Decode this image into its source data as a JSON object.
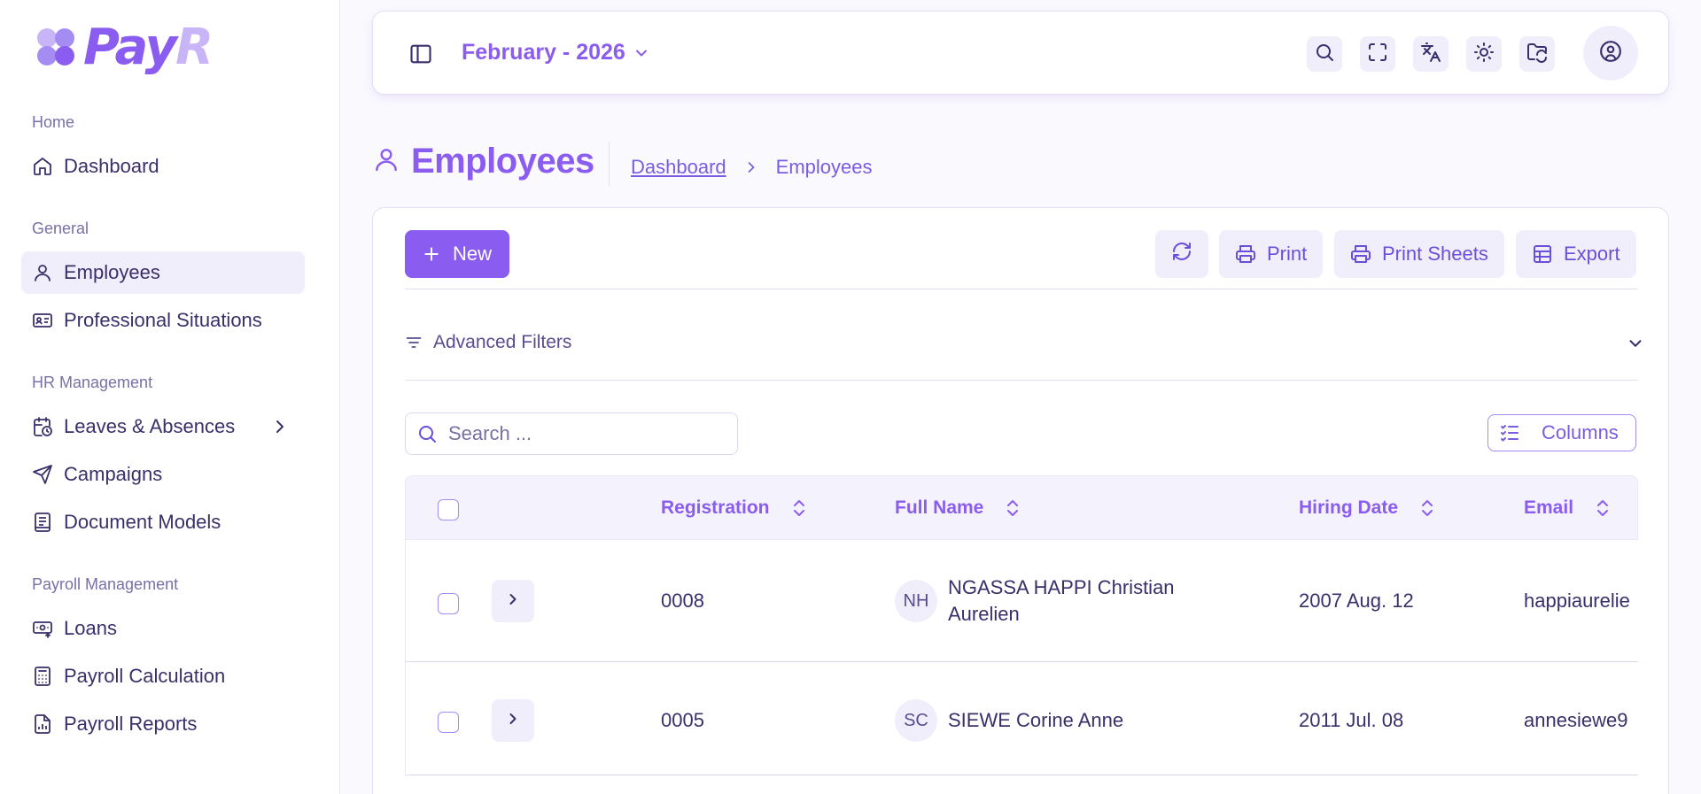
{
  "brand": {
    "name": "PayR",
    "colors": {
      "accent": "#8a5cf0",
      "accent_light": "#c7b5f7",
      "surface_tint": "#f1eefc",
      "text": "#3b2f6b"
    }
  },
  "sidebar": {
    "sections": [
      {
        "title": "Home",
        "items": [
          {
            "label": "Dashboard",
            "icon": "home-icon"
          }
        ]
      },
      {
        "title": "General",
        "items": [
          {
            "label": "Employees",
            "icon": "user-icon",
            "active": true
          },
          {
            "label": "Professional Situations",
            "icon": "id-card-icon"
          }
        ]
      },
      {
        "title": "HR Management",
        "items": [
          {
            "label": "Leaves & Absences",
            "icon": "calendar-clock-icon",
            "has_children": true
          },
          {
            "label": "Campaigns",
            "icon": "send-icon"
          },
          {
            "label": "Document Models",
            "icon": "document-icon"
          }
        ]
      },
      {
        "title": "Payroll Management",
        "items": [
          {
            "label": "Loans",
            "icon": "banknote-icon"
          },
          {
            "label": "Payroll Calculation",
            "icon": "calculator-icon"
          },
          {
            "label": "Payroll Reports",
            "icon": "chart-file-icon"
          }
        ]
      }
    ]
  },
  "topbar": {
    "period": "February - 2026",
    "icons": [
      "search-icon",
      "fullscreen-icon",
      "translate-icon",
      "sun-icon",
      "folder-sync-icon",
      "user-circle-icon"
    ]
  },
  "page": {
    "title": "Employees",
    "breadcrumb": {
      "link": "Dashboard",
      "current": "Employees"
    }
  },
  "toolbar": {
    "new_label": "New",
    "print_label": "Print",
    "print_sheets_label": "Print Sheets",
    "export_label": "Export"
  },
  "filters": {
    "label": "Advanced Filters"
  },
  "search": {
    "placeholder": "Search ..."
  },
  "columns_button": "Columns",
  "table": {
    "columns": [
      "Registration",
      "Full Name",
      "Hiring Date",
      "Email"
    ],
    "rows": [
      {
        "registration": "0008",
        "initials": "NH",
        "full_name": "NGASSA HAPPI Christian Aurelien",
        "hiring_date": "2007 Aug. 12",
        "email": "happiaurelie"
      },
      {
        "registration": "0005",
        "initials": "SC",
        "full_name": "SIEWE Corine Anne",
        "hiring_date": "2011 Jul. 08",
        "email": "annesiewe9"
      }
    ]
  }
}
